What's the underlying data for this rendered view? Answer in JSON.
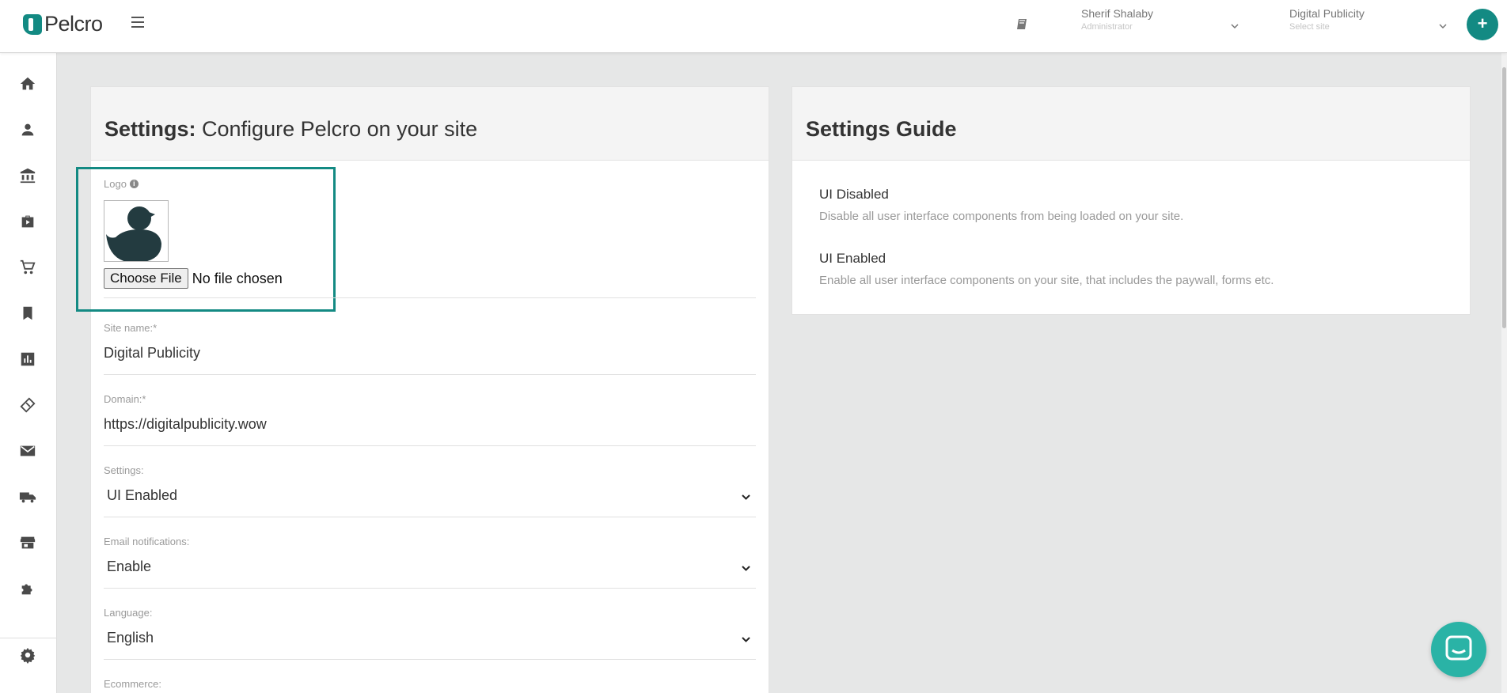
{
  "header": {
    "brand": "Pelcro",
    "user": {
      "name": "Sherif Shalaby",
      "role": "Administrator"
    },
    "site": {
      "name": "Digital Publicity",
      "placeholder": "Select site"
    },
    "add_label": "+"
  },
  "sidebar": {
    "items": [
      "home-icon",
      "user-icon",
      "bank-icon",
      "briefcase-play-icon",
      "cart-icon",
      "bookmark-icon",
      "chart-icon",
      "ticket-icon",
      "mail-icon",
      "truck-icon",
      "store-icon",
      "puzzle-icon"
    ],
    "footer_item": "gear-icon"
  },
  "settings_panel": {
    "title_bold": "Settings:",
    "title_rest": " Configure Pelcro on your site",
    "logo": {
      "label": "Logo",
      "choose_label": "Choose File",
      "file_status": "No file chosen"
    },
    "site_name": {
      "label": "Site name:*",
      "value": "Digital Publicity"
    },
    "domain": {
      "label": "Domain:*",
      "value": "https://digitalpublicity.wow"
    },
    "settings": {
      "label": "Settings:",
      "value": "UI Enabled"
    },
    "email_notifications": {
      "label": "Email notifications:",
      "value": "Enable"
    },
    "language": {
      "label": "Language:",
      "value": "English"
    },
    "ecommerce": {
      "label": "Ecommerce:"
    }
  },
  "guide_panel": {
    "title": "Settings Guide",
    "items": [
      {
        "title": "UI Disabled",
        "desc": "Disable all user interface components from being loaded on your site."
      },
      {
        "title": "UI Enabled",
        "desc": "Enable all user interface components on your site, that includes the paywall, forms etc."
      }
    ]
  },
  "colors": {
    "accent": "#138a83",
    "chat": "#2ab3a6"
  }
}
